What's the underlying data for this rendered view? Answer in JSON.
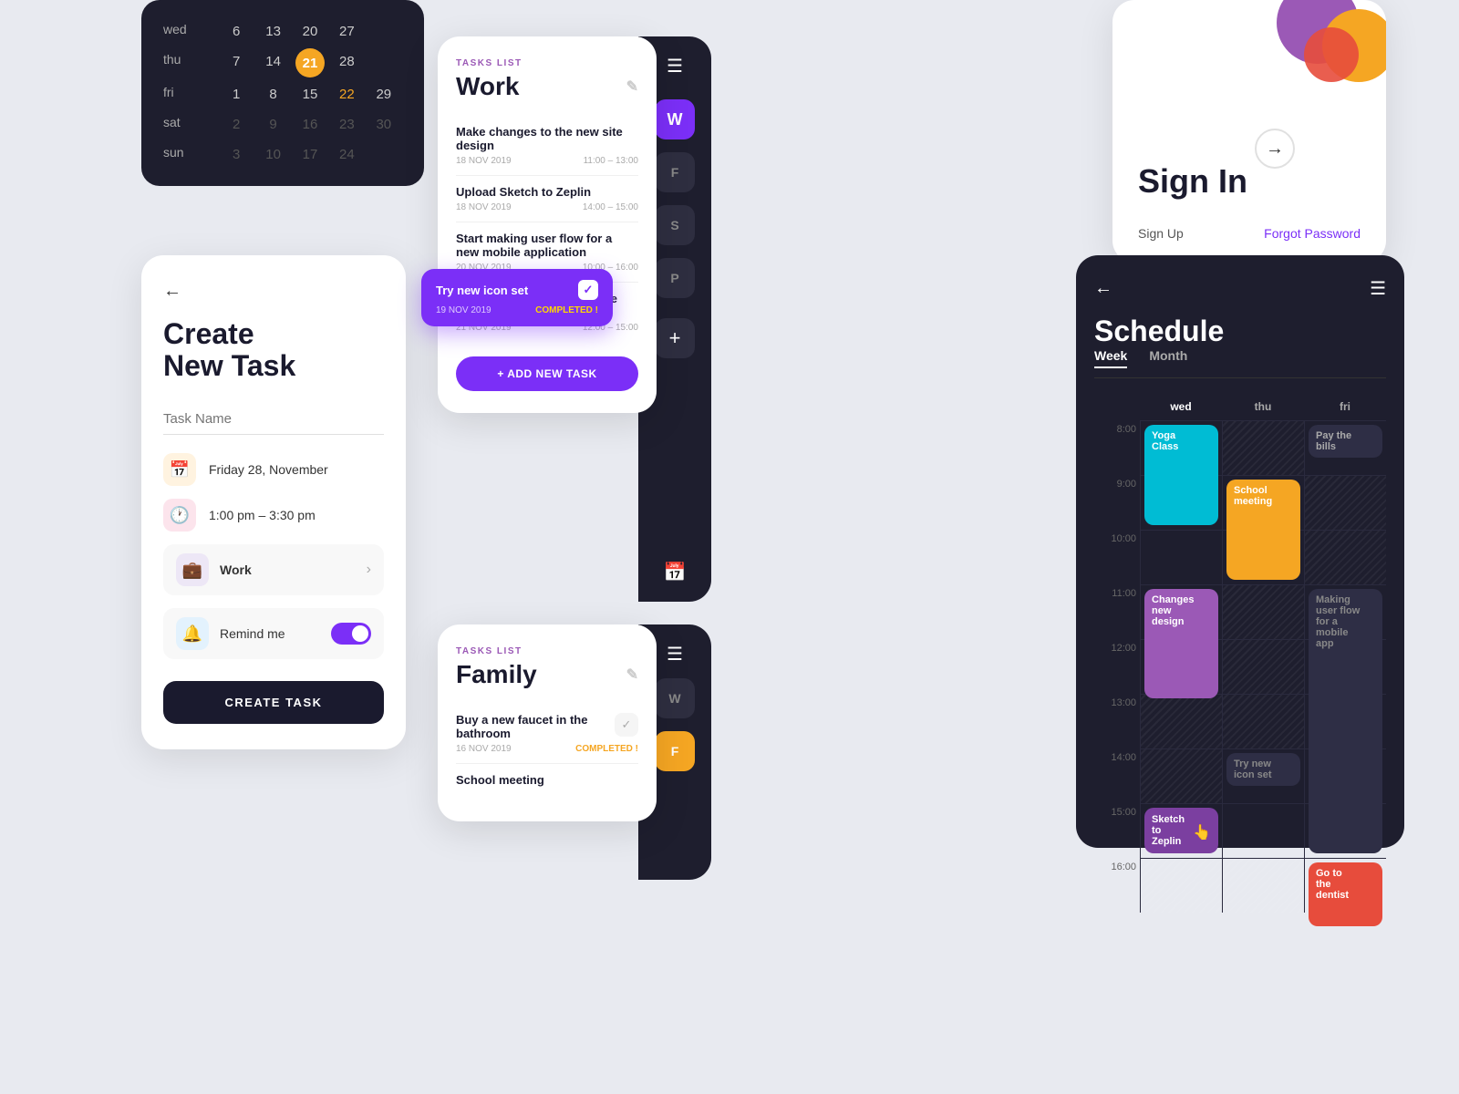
{
  "calendar": {
    "days": [
      "wed",
      "thu",
      "fri",
      "sat",
      "sun"
    ],
    "rows": [
      {
        "label": "wed",
        "nums": [
          "6",
          "13",
          "20",
          "27",
          ""
        ]
      },
      {
        "label": "thu",
        "nums": [
          "7",
          "14",
          "21",
          "28",
          ""
        ]
      },
      {
        "label": "fri",
        "nums": [
          "1",
          "8",
          "15",
          "22",
          "29"
        ]
      },
      {
        "label": "sat",
        "nums": [
          "2",
          "9",
          "16",
          "23",
          "30"
        ]
      },
      {
        "label": "sun",
        "nums": [
          "3",
          "10",
          "17",
          "24",
          ""
        ]
      }
    ],
    "today": "21",
    "highlighted": [
      "22"
    ]
  },
  "tasks_work": {
    "label": "TASKS LIST",
    "title": "Work",
    "edit_icon": "✎",
    "items": [
      {
        "name": "Make changes to the new site design",
        "date": "18 NOV 2019",
        "time": "11:00 – 13:00"
      },
      {
        "name": "Upload Sketch to Zeplin",
        "date": "18 NOV 2019",
        "time": "14:00 – 15:00"
      },
      {
        "name": "Start making user flow for a new mobile application",
        "date": "20 NOV 2019",
        "time": "10:00 – 16:00"
      },
      {
        "name": "Make changes to the old site design",
        "date": "21 NOV 2019",
        "time": "12:00 – 15:00"
      }
    ],
    "add_button": "+ ADD NEW TASK"
  },
  "tooltip": {
    "task": "Try new icon set",
    "date": "19 NOV 2019",
    "status": "COMPLETED !"
  },
  "panel": {
    "menu_icon": "☰",
    "avatars": [
      "W",
      "F",
      "S",
      "P"
    ],
    "add": "+",
    "calendar_icon": "📅"
  },
  "create_task": {
    "back": "←",
    "title": "Create\nNew Task",
    "input_placeholder": "Task Name",
    "date": "Friday 28, November",
    "time": "1:00 pm – 3:30 pm",
    "category": "Work",
    "remind": "Remind me",
    "button": "CREATE TASK"
  },
  "signin": {
    "title": "Sign In",
    "arrow": "→",
    "signup": "Sign Up",
    "forgot": "Forgot Password"
  },
  "tasks_family": {
    "label": "TASKS LIST",
    "title": "Family",
    "edit_icon": "✎",
    "items": [
      {
        "name": "Buy a new faucet in the bathroom",
        "date": "16 NOV 2019",
        "status": "COMPLETED !"
      },
      {
        "name": "School meeting",
        "date": "",
        "time": ""
      }
    ]
  },
  "schedule": {
    "back": "←",
    "menu": "☰",
    "title": "Schedule",
    "tabs": [
      "Week",
      "Month"
    ],
    "active_tab": "Week",
    "columns": [
      "wed",
      "thu",
      "fri"
    ],
    "times": [
      "8:00",
      "9:00",
      "10:00",
      "11:00",
      "12:00",
      "13:00",
      "14:00",
      "15:00",
      "16:00"
    ],
    "events": {
      "yoga": {
        "label": "Yoga\nClass",
        "col": "wed",
        "start": 8,
        "end": 9.5,
        "color": "cyan"
      },
      "school": {
        "label": "School\nmeeting",
        "col": "thu",
        "start": 9,
        "end": 10.5,
        "color": "orange"
      },
      "changes": {
        "label": "Changes\nnew\ndesign",
        "col": "wed",
        "start": 11,
        "end": 13,
        "color": "purple"
      },
      "paybills": {
        "label": "Pay the\nbills",
        "col": "fri",
        "start": 8,
        "end": 9,
        "color": "dark"
      },
      "userflow": {
        "label": "Making\nuser flow\nfor a\nmobile\napp",
        "col": "fri",
        "start": 11,
        "end": 16,
        "color": "dark"
      },
      "trynew": {
        "label": "Try new\nicon set",
        "col": "thu",
        "start": 14,
        "end": 15,
        "color": "dark"
      },
      "sketch": {
        "label": "Sketch\nto Zeplin",
        "col": "wed",
        "start": 15,
        "end": 16,
        "color": "purple_dark"
      },
      "dentist": {
        "label": "Go to\nthe\ndentist",
        "col": "fri",
        "start": 16,
        "end": 17,
        "color": "red"
      }
    }
  }
}
